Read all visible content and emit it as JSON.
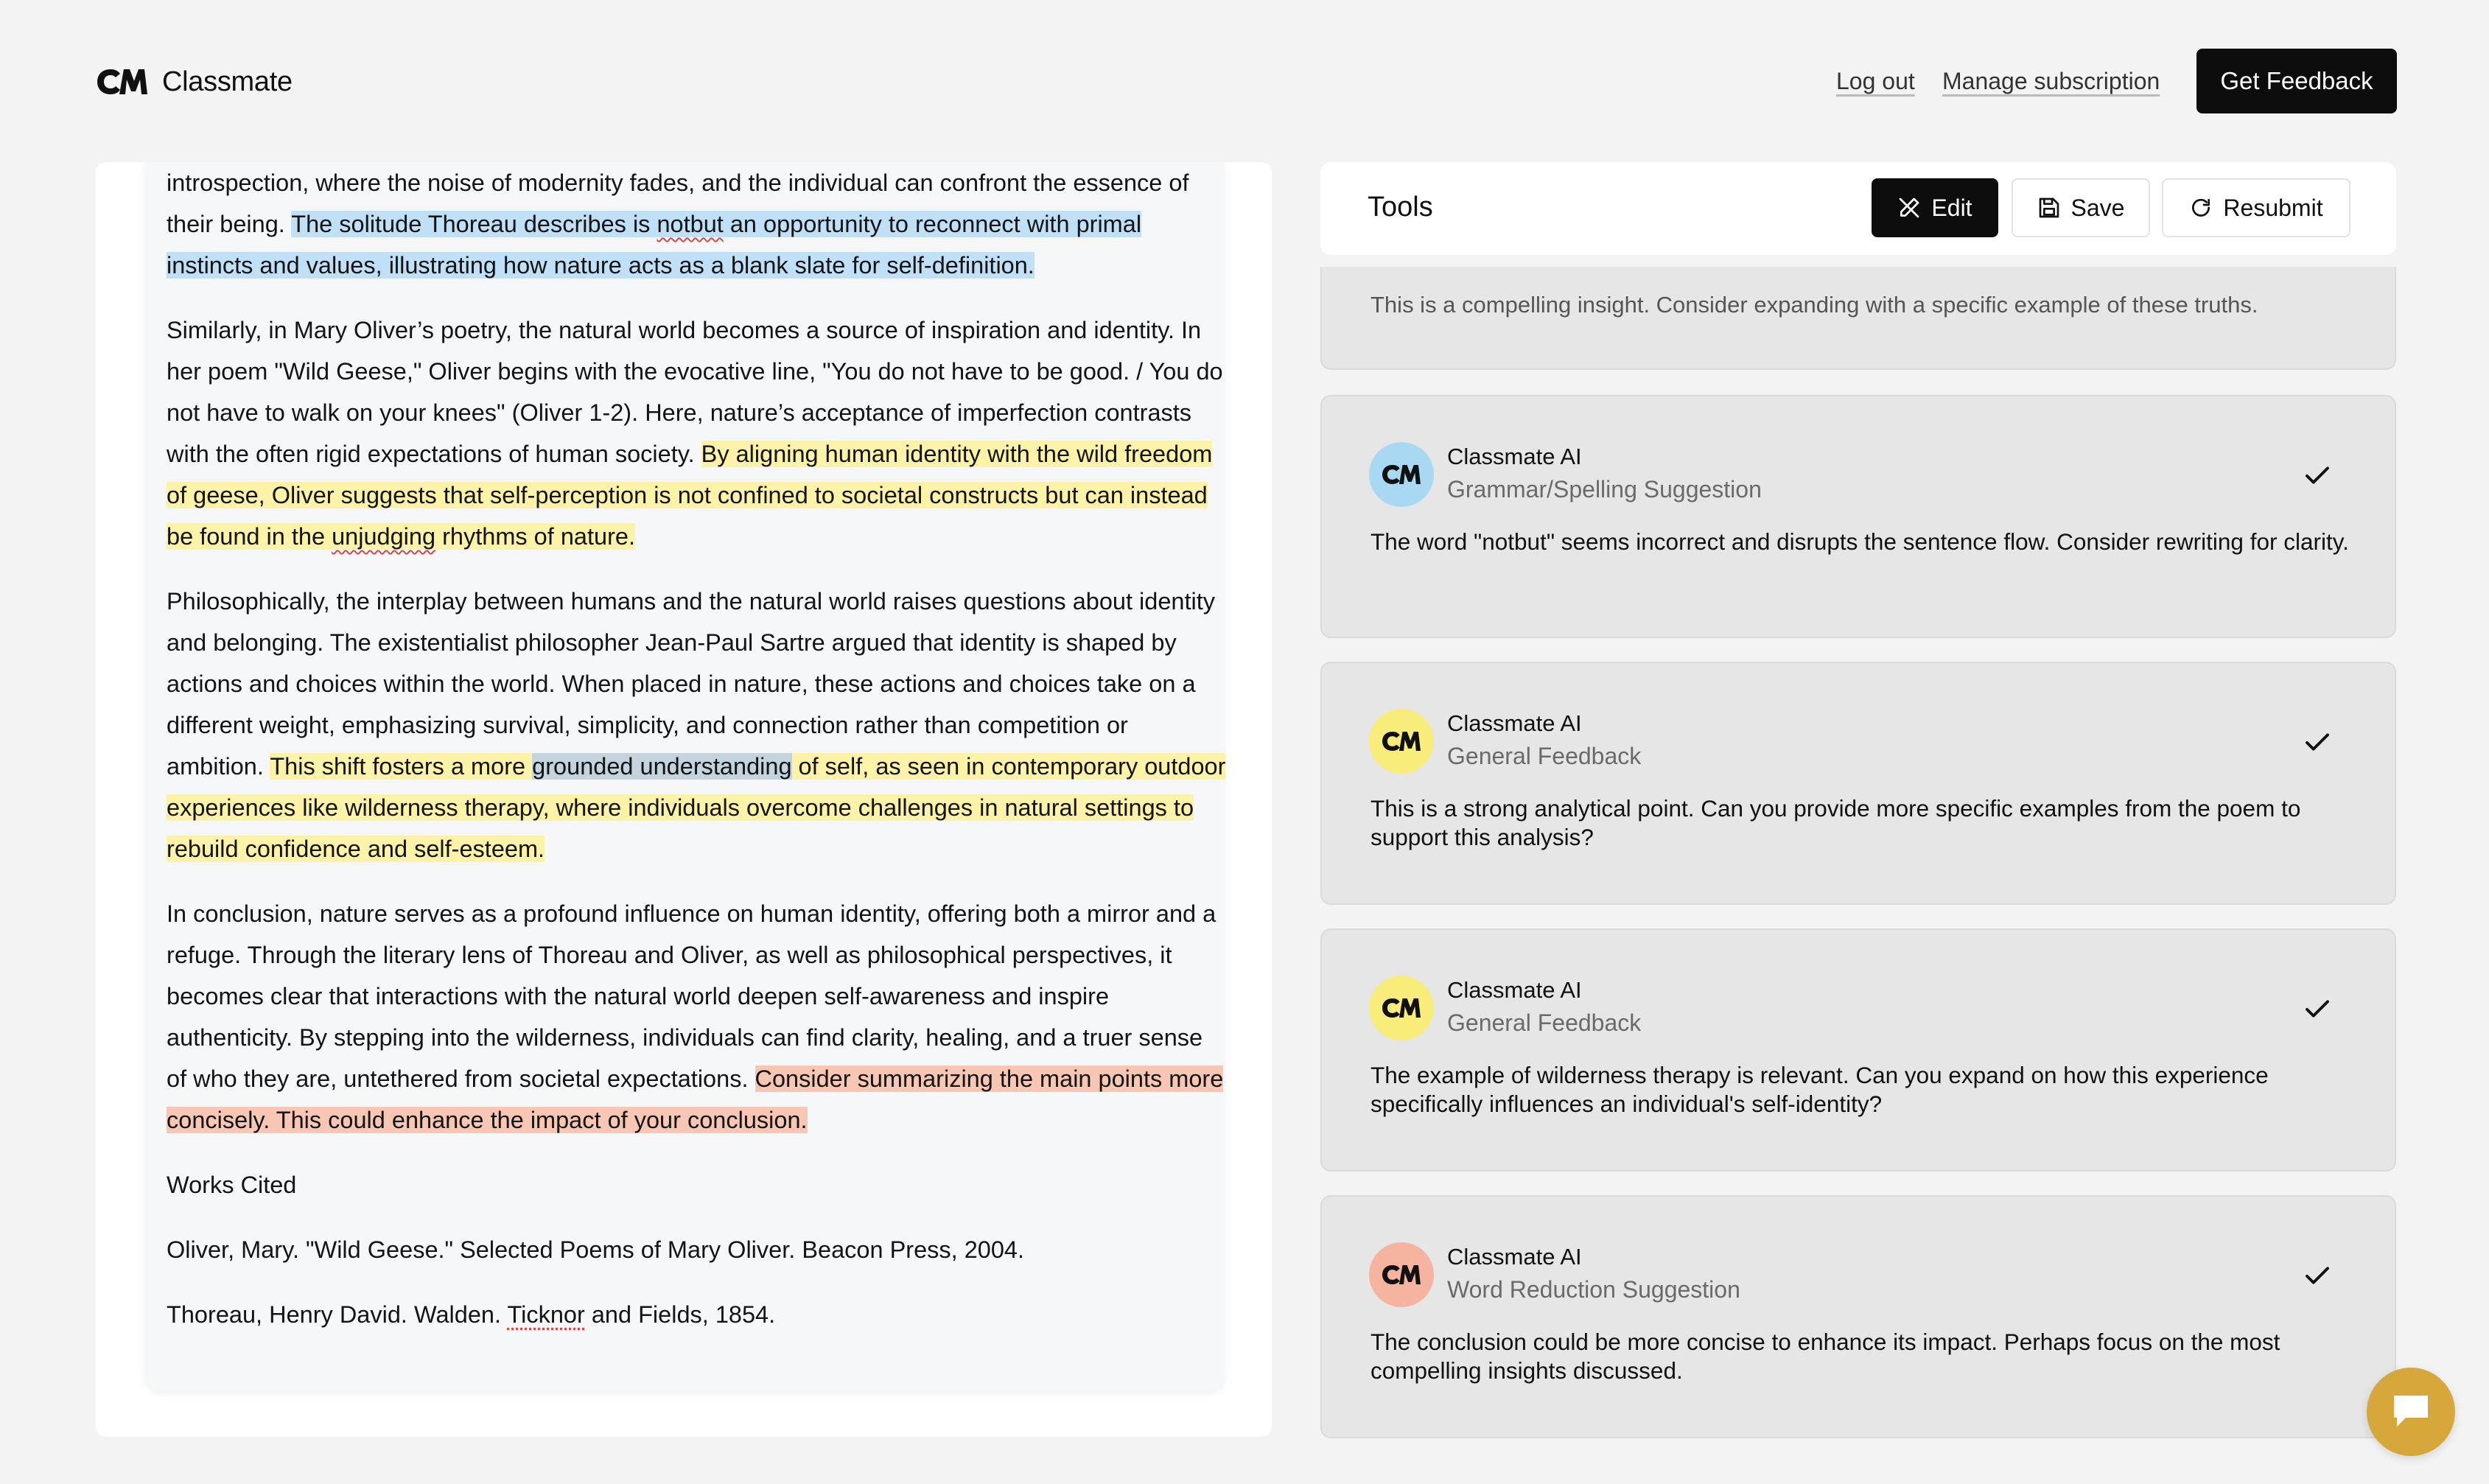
{
  "header": {
    "brand": "Classmate",
    "logout": "Log out",
    "manage": "Manage subscription",
    "get_feedback": "Get Feedback"
  },
  "document": {
    "p1": {
      "plain": "introspection, where the noise of modernity fades, and the individual can confront the essence of their being. ",
      "hl_a": "The solitude Thoreau describes is ",
      "hl_word": "notbut",
      "hl_b": " an opportunity to reconnect with primal instincts and values, illustrating how nature acts as a blank slate for self-definition."
    },
    "p2": {
      "plain": "Similarly, in Mary Oliver’s poetry, the natural world becomes a source of inspiration and identity. In her poem \"Wild Geese,\" Oliver begins with the evocative line, \"You do not have to be good. / You do not have to walk on your knees\" (Oliver 1-2). Here, nature’s acceptance of imperfection contrasts with the often rigid expectations of human society. ",
      "hl_a": "By aligning human identity with the wild freedom of geese, Oliver suggests that self-perception is not confined to societal constructs but can instead be found in the ",
      "hl_word": "unjudging",
      "hl_b": " rhythms of nature."
    },
    "p3": {
      "plain": "Philosophically, the interplay between humans and the natural world raises questions about identity and belonging. The existentialist philosopher Jean-Paul Sartre argued that identity is shaped by actions and choices within the world. When placed in nature, these actions and choices take on a different weight, emphasizing survival, simplicity, and connection rather than competition or ambition. ",
      "hl_a": "This shift fosters a more ",
      "hl_grey": "grounded understanding",
      "hl_b": " of self, as seen in contemporary outdoor experiences like wilderness therapy, where individuals overcome challenges in natural settings to rebuild confidence and self-esteem."
    },
    "p4": {
      "plain": "In conclusion, nature serves as a profound influence on human identity, offering both a mirror and a refuge. Through the literary lens of Thoreau and Oliver, as well as philosophical perspectives, it becomes clear that interactions with the natural world deepen self-awareness and inspire authenticity. By stepping into the wilderness, individuals can find clarity, healing, and a truer sense of who they are, untethered from societal expectations. ",
      "hl_red": "Consider summarizing the main points more concisely. This could enhance the impact of your conclusion."
    },
    "works_cited": "Works Cited",
    "cite1": "Oliver, Mary. \"Wild Geese.\" Selected Poems of Mary Oliver. Beacon Press, 2004.",
    "cite2_a": "Thoreau, Henry David. Walden. ",
    "cite2_word": "Ticknor",
    "cite2_b": " and Fields, 1854."
  },
  "tools": {
    "title": "Tools",
    "edit": "Edit",
    "save": "Save",
    "resubmit": "Resubmit"
  },
  "feedback": {
    "partial": "This is a compelling insight. Consider expanding with a specific example of these truths.",
    "cards": [
      {
        "author": "Classmate AI",
        "type": "Grammar/Spelling Suggestion",
        "body": "The word \"notbut\" seems incorrect and disrupts the sentence flow. Consider rewriting for clarity.",
        "color": "#a9d8f3"
      },
      {
        "author": "Classmate AI",
        "type": "General Feedback",
        "body": "This is a strong analytical point. Can you provide more specific examples from the poem to support this analysis?",
        "color": "#f8ec7a"
      },
      {
        "author": "Classmate AI",
        "type": "General Feedback",
        "body": "The example of wilderness therapy is relevant. Can you expand on how this experience specifically influences an individual's self-identity?",
        "color": "#f8ec7a"
      },
      {
        "author": "Classmate AI",
        "type": "Word Reduction Suggestion",
        "body": "The conclusion could be more concise to enhance its impact. Perhaps focus on the most compelling insights discussed.",
        "color": "#f4b4a0"
      }
    ]
  },
  "icons": {
    "logo": "classmate-logo-icon",
    "edit": "edit-pen-icon",
    "save": "floppy-disk-icon",
    "resubmit": "refresh-icon",
    "check": "check-icon",
    "chat": "chat-bubble-icon"
  },
  "colors": {
    "highlight_blue": "#bfe0f7",
    "highlight_yellow": "#fcf2a8",
    "highlight_grey": "#c3d4de",
    "highlight_red": "#f7c7b4",
    "chat_button": "#d6a83c"
  }
}
